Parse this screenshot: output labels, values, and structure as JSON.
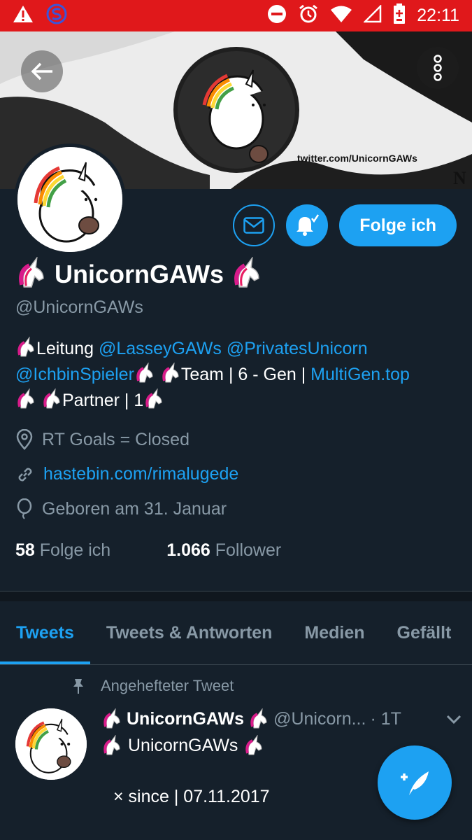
{
  "status_bar": {
    "time": "22:11"
  },
  "banner": {
    "url_text": "twitter.com/UnicornGAWs"
  },
  "buttons": {
    "follow_label": "Folge ich"
  },
  "profile": {
    "name": "UnicornGAWs",
    "handle": "@UnicornGAWs",
    "bio": {
      "line1_text": "Leitung ",
      "mention1": "@LasseyGAWs",
      "mention2": "@PrivatesUnicorn",
      "mention3": "@IchbinSpieler",
      "team_text": "Team | 6 - Gen | ",
      "link": "MultiGen.top",
      "partner_text": "Partner | 1"
    },
    "location": "RT Goals = Closed",
    "website": "hastebin.com/rimalugede",
    "birthday": "Geboren am 31. Januar",
    "following_count": "58",
    "following_label": "Folge ich",
    "followers_count": "1.066",
    "followers_label": "Follower"
  },
  "tabs": [
    "Tweets",
    "Tweets & Antworten",
    "Medien",
    "Gefällt"
  ],
  "active_tab": "Tweets",
  "tweet": {
    "pinned_label": "Angehefteter Tweet",
    "author_name": "UnicornGAWs",
    "author_handle": "@Unicorn...",
    "time": "· 1T",
    "text_line1": "UnicornGAWs",
    "text_line2": "× since | 07.11.2017"
  },
  "colors": {
    "accent": "#1da1f2",
    "background": "#15202b",
    "status_bar": "#e0181b",
    "secondary_text": "#8899a6"
  }
}
